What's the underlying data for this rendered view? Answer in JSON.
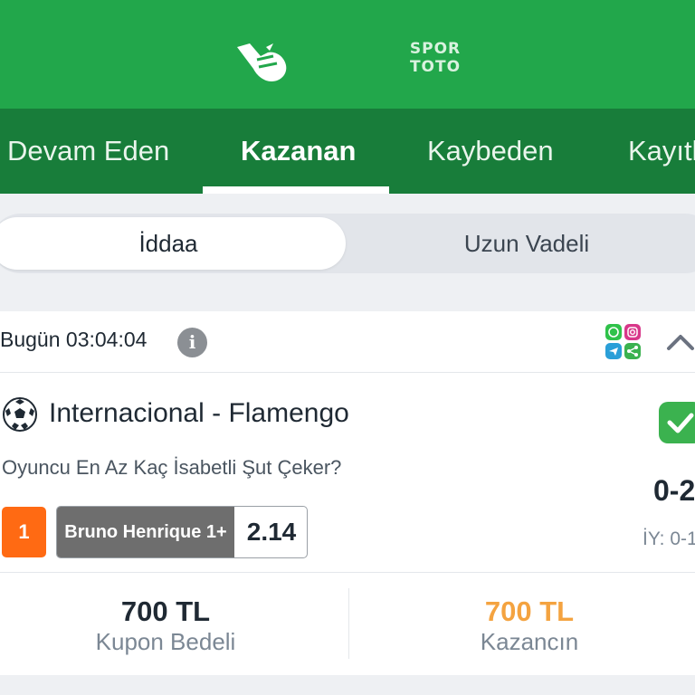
{
  "header": {
    "logos": [
      {
        "name": "iddaa-logo",
        "icon": "iddaa-hand-icon"
      },
      {
        "name": "spor-toto-logo",
        "line1": "SPOR",
        "line2": "TOTO"
      }
    ],
    "bg_color": "#22a74b"
  },
  "tabs": [
    {
      "label": "Devam Eden",
      "active": false
    },
    {
      "label": "Kazanan",
      "active": true
    },
    {
      "label": "Kaybeden",
      "active": false
    },
    {
      "label": "Kayıtl",
      "active": false
    }
  ],
  "segment": {
    "options": [
      "İddaa",
      "Uzun Vadeli"
    ],
    "selected": "İddaa"
  },
  "coupon": {
    "date": "Bugün 03:04:04",
    "info_icon": "info-icon",
    "share_icons": [
      "whatsapp-icon",
      "instagram-icon",
      "telegram-icon",
      "share-icon"
    ],
    "collapse_icon": "chevron-up-icon",
    "match": {
      "sport_icon": "soccer-ball-icon",
      "title": "Internacional - Flamengo",
      "market": "Oyuncu En Az Kaç İsabetli Şut Çeker?",
      "score": "0-2",
      "half_time": "İY: 0-1",
      "status_icon": "check-icon",
      "selection_no": "1",
      "pick": "Bruno Henrique 1+",
      "odd": "2.14"
    },
    "stake": {
      "value": "700 TL",
      "label": "Kupon Bedeli"
    },
    "win": {
      "value": "700 TL",
      "label": "Kazancın"
    }
  },
  "colors": {
    "brand_green": "#22a74b",
    "tab_bar": "#187d3a",
    "win_orange": "#f4a340",
    "badge_orange": "#ff6a13",
    "check_green": "#3bb24f"
  }
}
